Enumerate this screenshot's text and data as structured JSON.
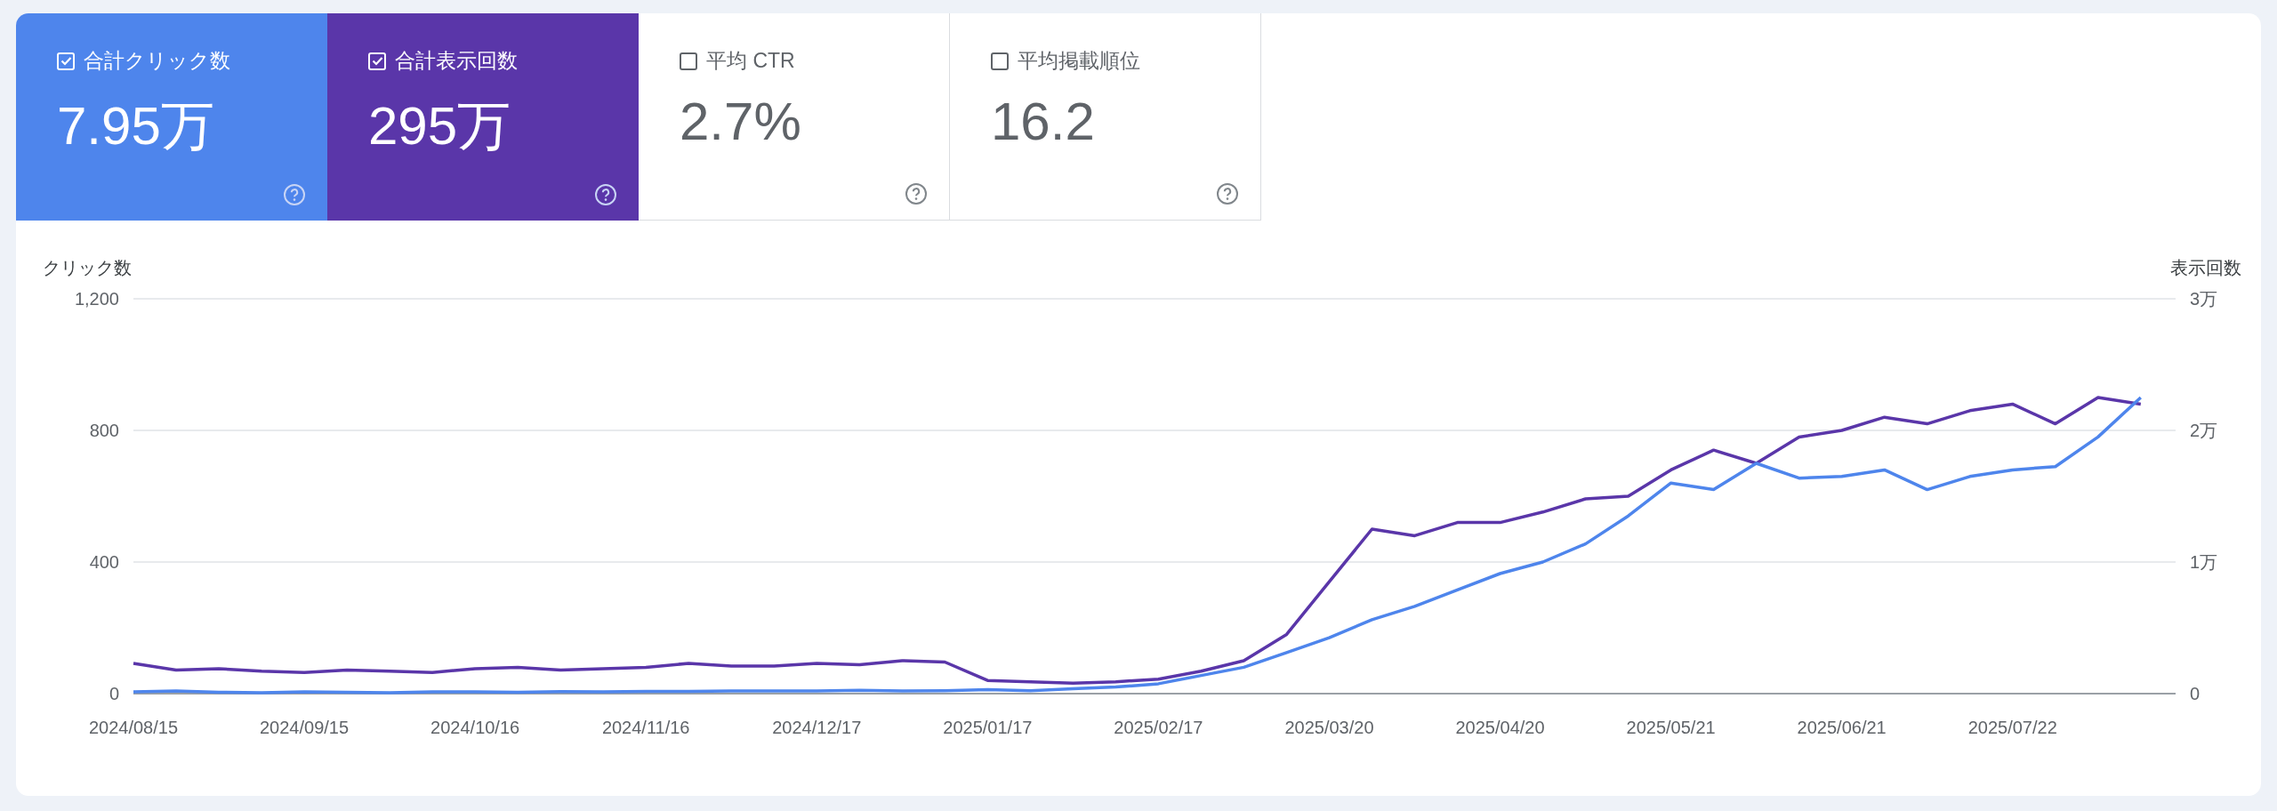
{
  "metrics": [
    {
      "label": "合計クリック数",
      "value": "7.95万",
      "checked": true
    },
    {
      "label": "合計表示回数",
      "value": "295万",
      "checked": true
    },
    {
      "label": "平均 CTR",
      "value": "2.7%",
      "checked": false
    },
    {
      "label": "平均掲載順位",
      "value": "16.2",
      "checked": false
    }
  ],
  "chart": {
    "chart_data": {
      "type": "line",
      "ylabel": "クリック数",
      "y2label": "表示回数",
      "ylim": [
        0,
        1200
      ],
      "yticks": [
        {
          "value": 0,
          "label": "0"
        },
        {
          "value": 400,
          "label": "400"
        },
        {
          "value": 800,
          "label": "800"
        },
        {
          "value": 1200,
          "label": "1,200"
        }
      ],
      "y2lim": [
        0,
        3
      ],
      "y2ticks": [
        {
          "value": 0,
          "label": "0"
        },
        {
          "value": 1,
          "label": "1万"
        },
        {
          "value": 2,
          "label": "2万"
        },
        {
          "value": 3,
          "label": "3万"
        }
      ],
      "categories": [
        "2024/08/15",
        null,
        null,
        null,
        "2024/09/15",
        null,
        null,
        null,
        "2024/10/16",
        null,
        null,
        null,
        "2024/11/16",
        null,
        null,
        null,
        "2024/12/17",
        null,
        null,
        null,
        "2025/01/17",
        null,
        null,
        null,
        "2025/02/17",
        null,
        null,
        null,
        "2025/03/20",
        null,
        null,
        null,
        "2025/04/20",
        null,
        null,
        null,
        "2025/05/21",
        null,
        null,
        null,
        "2025/06/21",
        null,
        null,
        null,
        "2025/07/22",
        null,
        null,
        null
      ],
      "series": [
        {
          "color": "#4e85ec",
          "values": [
            5,
            8,
            4,
            3,
            5,
            4,
            3,
            5,
            5,
            4,
            6,
            5,
            7,
            7,
            8,
            8,
            8,
            10,
            8,
            9,
            12,
            9,
            15,
            20,
            30,
            55,
            80,
            125,
            170,
            225,
            265,
            315,
            365,
            400,
            455,
            540,
            640,
            620,
            700,
            655,
            660,
            680,
            620,
            660,
            680,
            690,
            780,
            900
          ]
        },
        {
          "color": "#5a36a9",
          "axis": "y2",
          "values": [
            0.23,
            0.18,
            0.19,
            0.17,
            0.16,
            0.18,
            0.17,
            0.16,
            0.19,
            0.2,
            0.18,
            0.19,
            0.2,
            0.23,
            0.21,
            0.21,
            0.23,
            0.22,
            0.25,
            0.24,
            0.1,
            0.09,
            0.08,
            0.09,
            0.11,
            0.17,
            0.25,
            0.45,
            0.85,
            1.25,
            1.2,
            1.3,
            1.3,
            1.38,
            1.48,
            1.5,
            1.7,
            1.85,
            1.75,
            1.95,
            2.0,
            2.1,
            2.05,
            2.15,
            2.2,
            2.05,
            2.25,
            2.2
          ]
        }
      ]
    }
  }
}
